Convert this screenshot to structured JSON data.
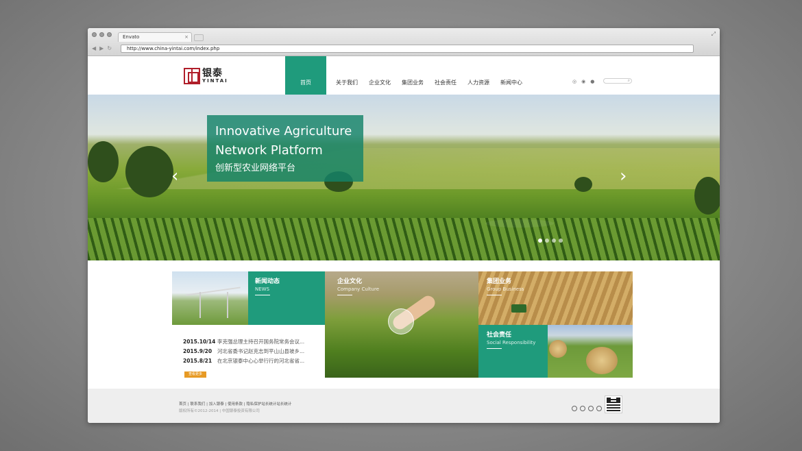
{
  "browser": {
    "tab_title": "Envato",
    "tab_close": "×",
    "url": "http://www.china-yintai.com/index.php",
    "back": "◀",
    "forward": "▶",
    "reload": "↻",
    "expand": "⤢"
  },
  "header": {
    "logo_cn": "银泰",
    "logo_en": "YINTAI",
    "menu": [
      "首页",
      "关于我们",
      "企业文化",
      "集团业务",
      "社会责任",
      "人力资源",
      "新闻中心"
    ],
    "active_menu": "首页"
  },
  "hero": {
    "title_line1": "Innovative Agriculture",
    "title_line2": "Network Platform",
    "title_cn": "创新型农业网络平台",
    "prev": "‹",
    "next": "›"
  },
  "tiles": {
    "news": {
      "title": "新闻动态",
      "subtitle": "NEWS"
    },
    "culture": {
      "title": "企业文化",
      "subtitle": "Company Culture"
    },
    "group": {
      "title": "集团业务",
      "subtitle": "Group Business"
    },
    "social": {
      "title": "社会责任",
      "subtitle": "Social Responsibility"
    }
  },
  "news_list": [
    {
      "date": "2015.10/14",
      "title": "李克强总理主持召开国务院常务会议..."
    },
    {
      "date": "2015.9/20",
      "title": "河北省委书记赵克志到平山山县坡乡..."
    },
    {
      "date": "2015.8/21",
      "title": "在北京银泰中心心举行行的河北省省..."
    }
  ],
  "more_button": "查看更多",
  "footer": {
    "links": "首页 | 联系我们 | 加入银泰 | 使用条款 | 隐私保护站长统计站长统计",
    "copyright": "版权所有©2012-2014 | 中国银泰投资有限公司"
  },
  "colors": {
    "accent": "#1f9b7c",
    "more_button": "#e79a24",
    "logo": "#b01e2a"
  }
}
